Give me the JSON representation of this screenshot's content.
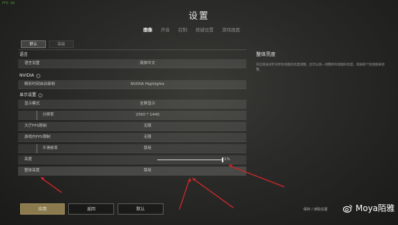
{
  "page": {
    "corner_mark": "FPS 60"
  },
  "title": "设置",
  "top_tabs": [
    {
      "label": "图像",
      "active": true
    },
    {
      "label": "声音",
      "active": false
    },
    {
      "label": "控制",
      "active": false
    },
    {
      "label": "按键设置",
      "active": false
    },
    {
      "label": "游戏画面",
      "active": false
    }
  ],
  "sub_tabs": [
    {
      "label": "默认",
      "active": true
    },
    {
      "label": "高级",
      "active": false
    }
  ],
  "sections": {
    "language": {
      "title": "语言",
      "row": {
        "label": "语言设置",
        "value": "简体中文"
      }
    },
    "nvidia": {
      "title": "NVIDIA",
      "row": {
        "label": "精彩时刻自动录制",
        "value": "NVIDIA Highlights"
      }
    },
    "display": {
      "title": "显示设置",
      "rows": {
        "display_mode": {
          "label": "显示模式",
          "value": "全屏显示"
        },
        "resolution": {
          "label": "分辨率",
          "value": "2560 * 1440"
        },
        "fps_limit": {
          "label": "大厅FPS限制",
          "value": "无限"
        },
        "ingame_fps": {
          "label": "游戏内FPS限制",
          "value": "无限"
        },
        "smooth_frame": {
          "label": "平滑帧率",
          "value": "禁用"
        },
        "brightness": {
          "label": "亮度",
          "value": "1%",
          "level_percent": 99
        },
        "overall_brightness": {
          "label": "整体亮度",
          "value": "禁用"
        }
      }
    }
  },
  "side_panel": {
    "title": "整体亮度",
    "description": "开启或关闭针对所有地图的亮度调整。您可以统一调整所有地图的亮度，或按照个别地图来调整。"
  },
  "buttons": {
    "apply": "应用",
    "back": "返回",
    "default": "默认"
  },
  "bottom_hint": "保存 / 读取设置",
  "watermark": {
    "text": "Moya陌雅"
  },
  "colors": {
    "arrow": "#c0282a",
    "apply_button": "#8a7a4e"
  }
}
